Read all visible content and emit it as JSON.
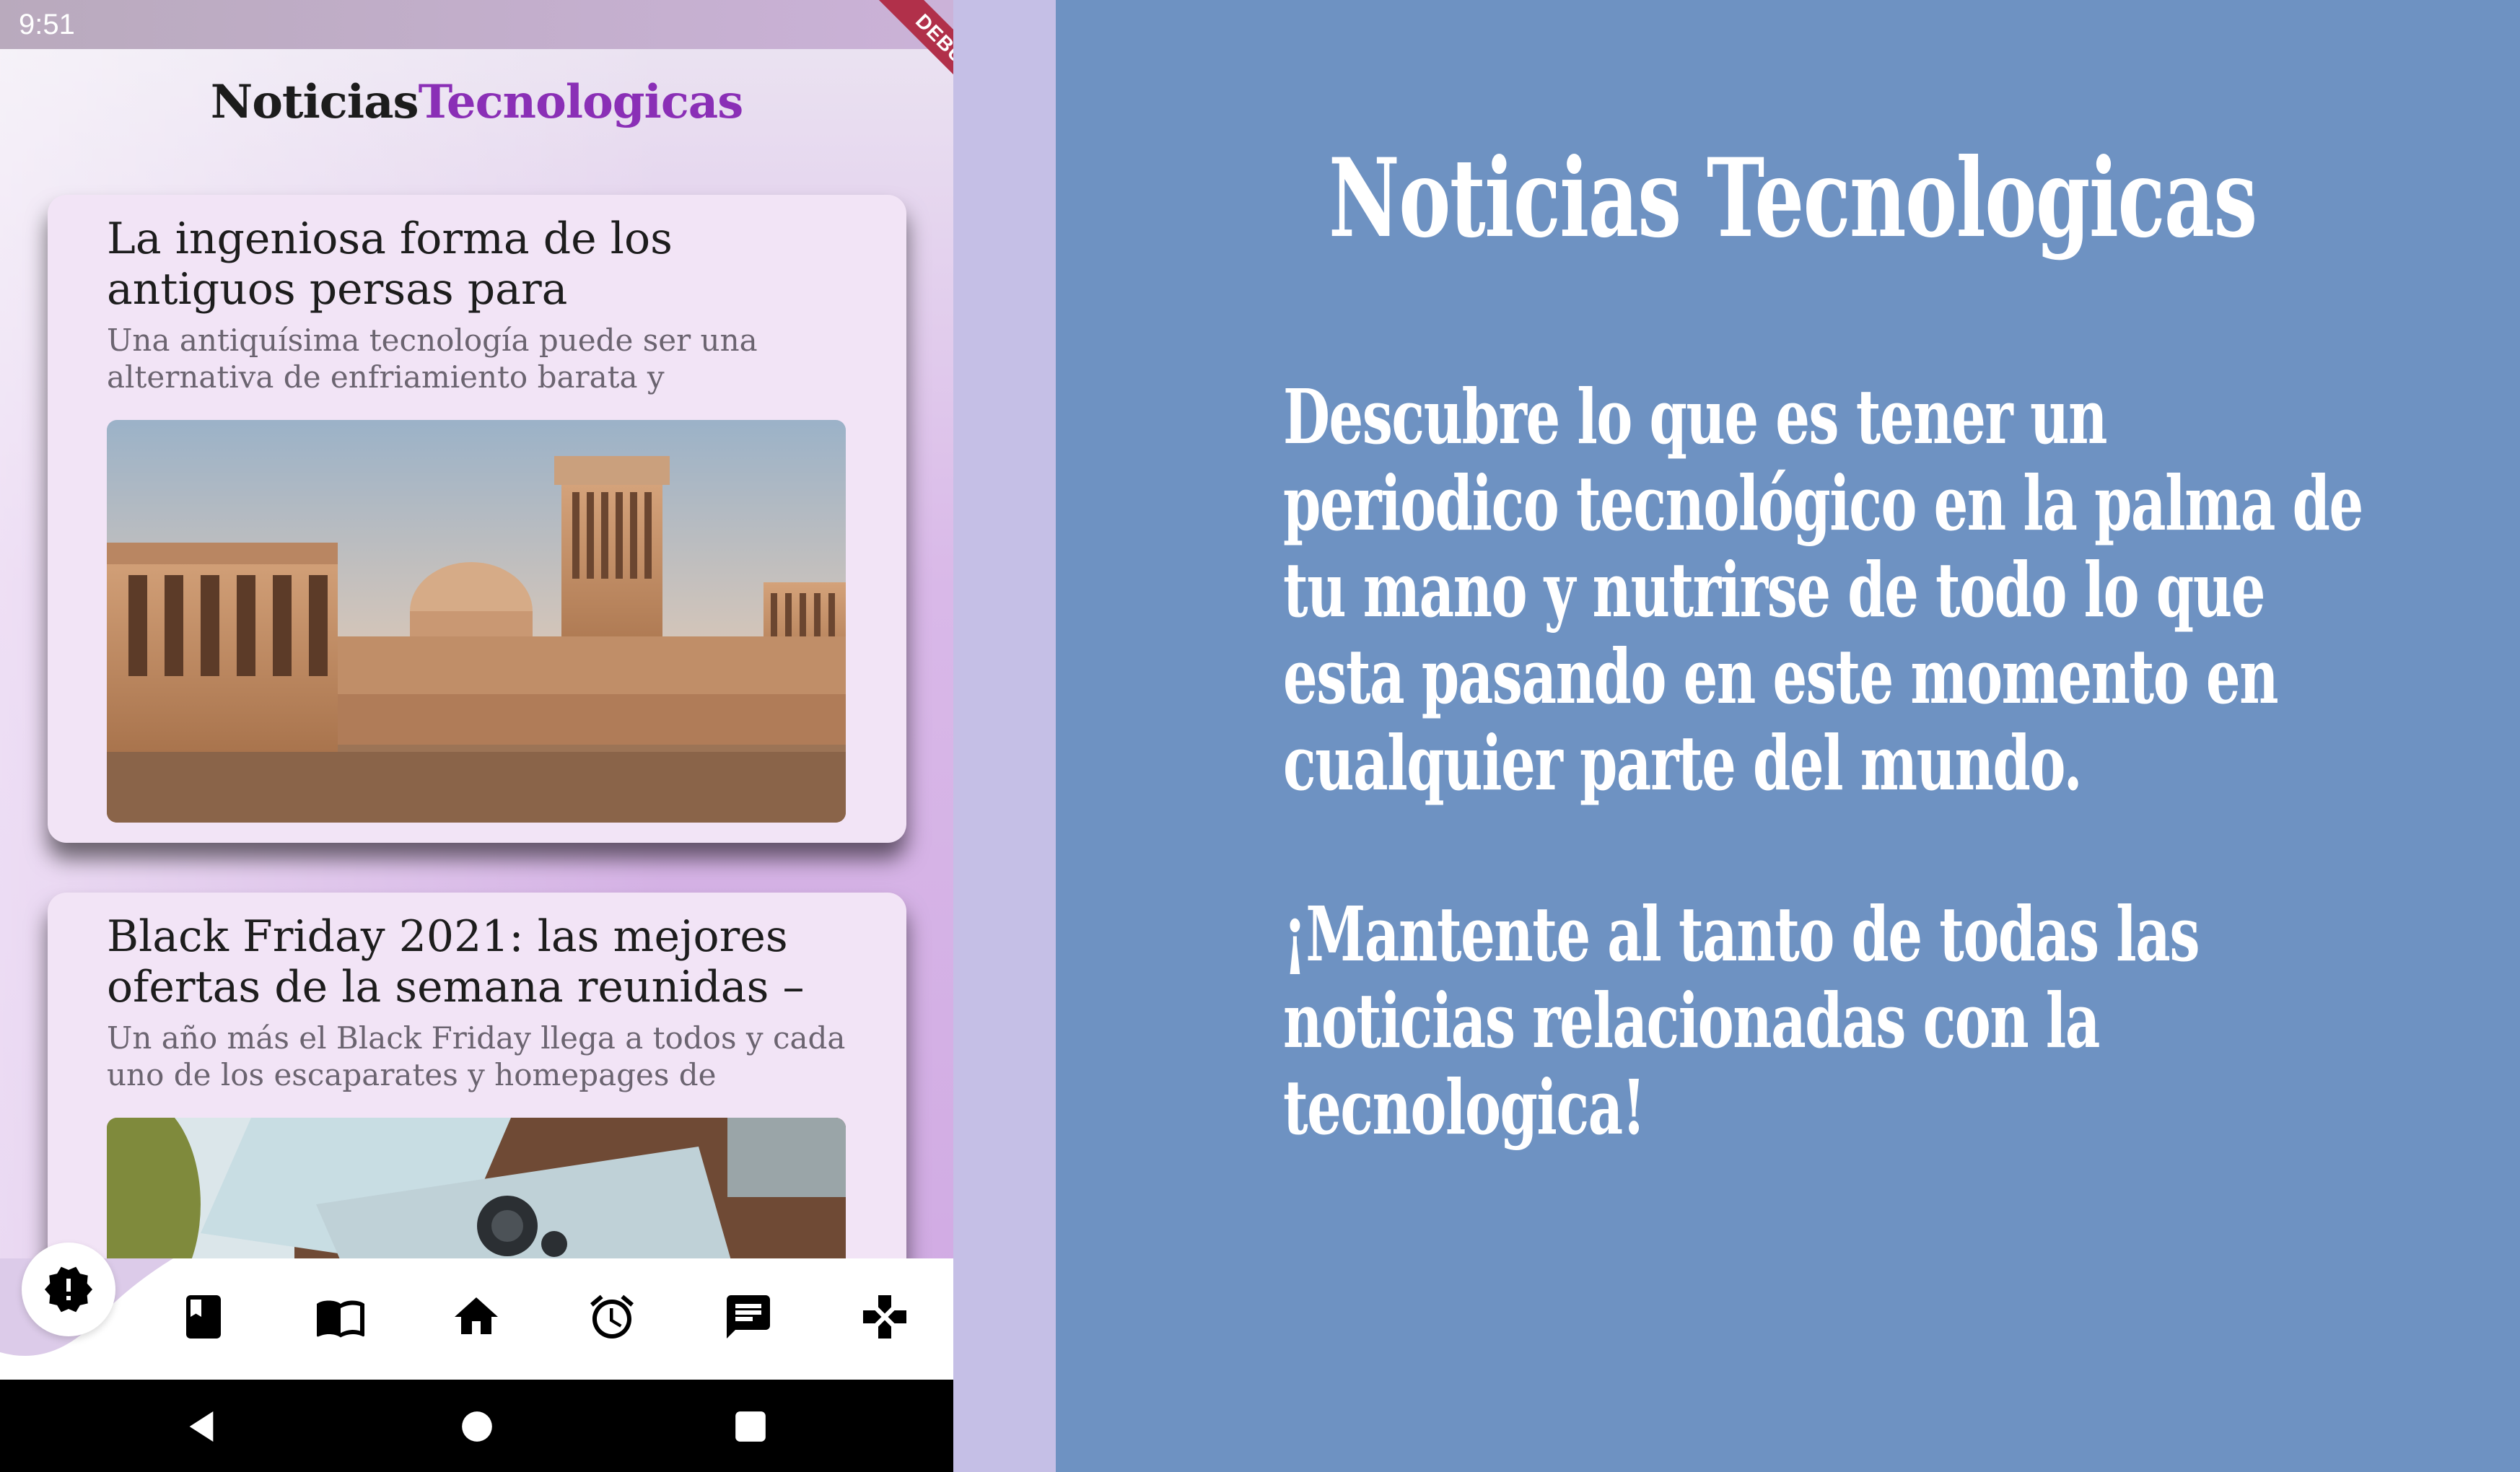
{
  "status_bar": {
    "time": "9:51",
    "debug_label": "DEBUG"
  },
  "app": {
    "title_part1": "Noticias",
    "title_part2": "Tecnologicas"
  },
  "articles": [
    {
      "title": "La ingeniosa forma de los antiguos persas para",
      "description": "Una antiquísima tecnología puede ser una alternativa de enfriamiento barata y"
    },
    {
      "title": "Black Friday 2021: las mejores ofertas de la semana reunidas –",
      "description": "Un año más el Black Friday llega a todos y cada uno de los escaparates y homepages de"
    }
  ],
  "bottom_nav": {
    "items": [
      {
        "icon": "new-releases-icon",
        "active": true
      },
      {
        "icon": "bookmark-icon"
      },
      {
        "icon": "menu-book-icon"
      },
      {
        "icon": "home-icon"
      },
      {
        "icon": "alarm-icon"
      },
      {
        "icon": "chat-icon"
      },
      {
        "icon": "gamepad-icon"
      }
    ]
  },
  "promo": {
    "title": "Noticias Tecnologicas",
    "body": "Descubre lo que es tener un periodico tecnológico en la palma de tu mano y nutrirse de todo lo que esta pasando en este momento en cualquier parte del mundo.",
    "cta": "¡Mantente al tanto de todas las noticias relacionadas con la tecnologica!"
  },
  "colors": {
    "promo_bg": "#6e92c2",
    "accent": "#8a2fb6",
    "card_bg": "#f2e4f6",
    "strip": "#c5bfe6"
  }
}
